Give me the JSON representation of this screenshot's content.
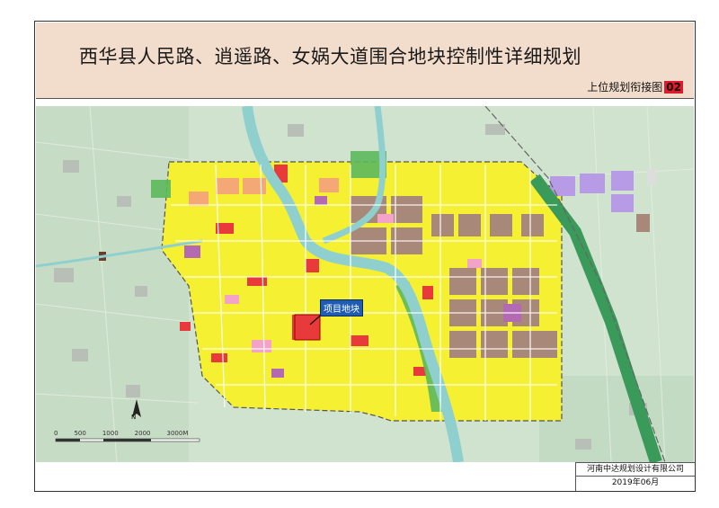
{
  "title": "西华县人民路、逍遥路、女娲大道围合地块控制性详细规划",
  "subtitle": {
    "label": "上位规划衔接图",
    "code": "02"
  },
  "callout": "项目地块",
  "north_label": "N",
  "scale": {
    "ticks": [
      "0",
      "500",
      "1000",
      "2000",
      "3000M"
    ]
  },
  "footer": {
    "company": "河南中达规划设计有限公司",
    "date": "2019年06月"
  },
  "colors": {
    "residential": "#f5f032",
    "commercial": "#e8393b",
    "industrial": "#a88878",
    "public": "#c080c0",
    "education": "#f3a3c8",
    "water": "#8fd0cf",
    "green": "#5cb85c",
    "rail": "#3a9a5a",
    "farmland": "#cfe3cf",
    "logistics": "#a88ae0"
  }
}
